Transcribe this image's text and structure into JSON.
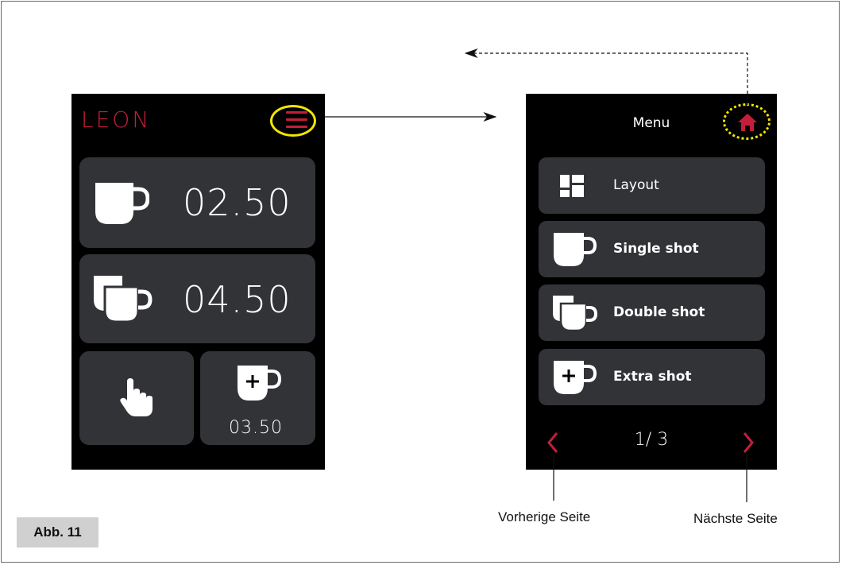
{
  "main_screen": {
    "logo": "LEON",
    "single_shot_price": "02.50",
    "double_shot_price": "04.50",
    "extra_shot_price": "03.50",
    "icons": {
      "menu": "hamburger-icon",
      "single": "single-cup-icon",
      "double": "double-cup-icon",
      "manual": "pointing-hand-icon",
      "extra": "cup-plus-icon"
    }
  },
  "menu_screen": {
    "title": "Menu",
    "items": [
      {
        "label": "Layout",
        "icon": "layout-icon"
      },
      {
        "label": "Single shot",
        "icon": "single-cup-icon"
      },
      {
        "label": "Double shot",
        "icon": "double-cup-icon"
      },
      {
        "label": "Extra shot",
        "icon": "cup-plus-icon"
      }
    ],
    "page_indicator": "1/ 3",
    "icons": {
      "home": "home-icon",
      "prev": "chevron-left-icon",
      "next": "chevron-right-icon"
    }
  },
  "annotations": {
    "prev_page": "Vorherige Seite",
    "next_page": "Nächste Seite",
    "figure_label": "Abb. 11"
  },
  "colors": {
    "accent_red": "#c41e3a",
    "highlight_yellow": "#f3e600",
    "tile_bg": "#323336",
    "screen_bg": "#000000"
  }
}
